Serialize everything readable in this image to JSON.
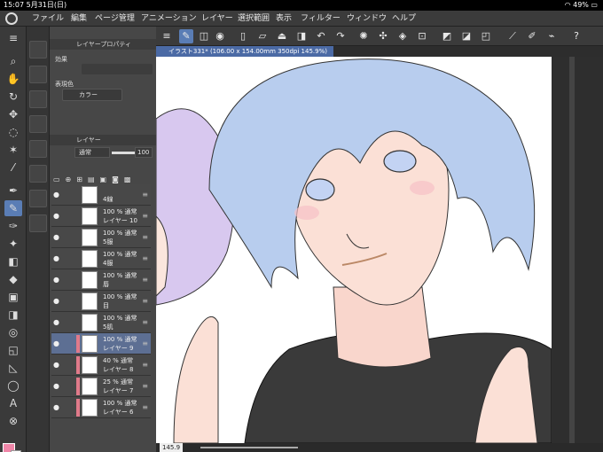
{
  "status": {
    "time": "15:07",
    "date": "5月31日(日)",
    "battery": "49%"
  },
  "menu": {
    "items": [
      "ファイル",
      "編集",
      "ページ管理",
      "アニメーション",
      "レイヤー",
      "選択範囲",
      "表示",
      "フィルター",
      "ウィンドウ",
      "ヘルプ"
    ]
  },
  "panels": {
    "layer_property": "レイヤープロパティ",
    "effect_label": "効果",
    "expression_color_label": "表現色",
    "expression_color_value": "カラー",
    "layer_title": "レイヤー",
    "blend_mode": "通常",
    "opacity": "100"
  },
  "layers": [
    {
      "pct": "",
      "name": "4線",
      "selected": false,
      "marked": false
    },
    {
      "pct": "100 % 通常",
      "name": "レイヤー 10",
      "selected": false,
      "marked": false
    },
    {
      "pct": "100 % 通常",
      "name": "5服",
      "selected": false,
      "marked": false
    },
    {
      "pct": "100 % 通常",
      "name": "4服",
      "selected": false,
      "marked": false
    },
    {
      "pct": "100 % 通常",
      "name": "唇",
      "selected": false,
      "marked": false
    },
    {
      "pct": "100 % 通常",
      "name": "目",
      "selected": false,
      "marked": false
    },
    {
      "pct": "100 % 通常",
      "name": "5肌",
      "selected": false,
      "marked": false
    },
    {
      "pct": "100 % 通常",
      "name": "レイヤー 9",
      "selected": true,
      "marked": true
    },
    {
      "pct": "40 % 通常",
      "name": "レイヤー 8",
      "selected": false,
      "marked": true
    },
    {
      "pct": "25 % 通常",
      "name": "レイヤー 7",
      "selected": false,
      "marked": true
    },
    {
      "pct": "100 % 通常",
      "name": "レイヤー 6",
      "selected": false,
      "marked": true
    }
  ],
  "doc": {
    "tab": "イラスト331* (106.00 x 154.00mm 350dpi 145.9%)",
    "zoom": "145.9"
  }
}
